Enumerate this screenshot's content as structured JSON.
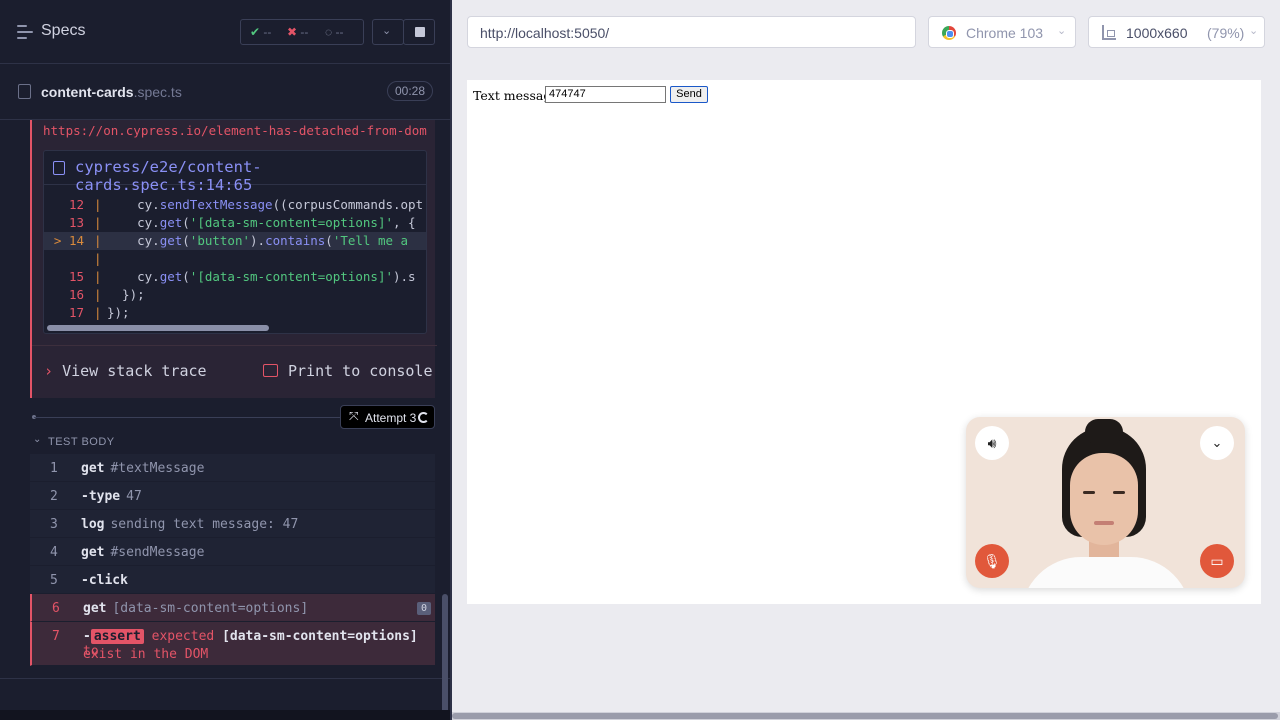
{
  "header": {
    "title": "Specs",
    "stats": {
      "passed": "--",
      "failed": "--",
      "pending": "--"
    }
  },
  "spec": {
    "name": "content-cards",
    "ext": ".spec.ts",
    "duration": "00:28"
  },
  "error": {
    "link": "https://on.cypress.io/element-has-detached-from-dom",
    "code_file": "cypress/e2e/content-cards.spec.ts:14:65",
    "code_lines": [
      {
        "num": "12",
        "pre": "    cy.",
        "fn": "sendTextMessage",
        "rest": "(corpusCommands.opt"
      },
      {
        "num": "13",
        "pre": "    cy.",
        "fn": "get",
        "str": "'[data-sm-content=options]'",
        "rest": ", {"
      },
      {
        "num": "> 14",
        "pre": "    cy.",
        "fn": "get",
        "str": "'button'",
        "rest": ").",
        "fn2": "contains",
        "str2": "'Tell me a"
      },
      {
        "num": "",
        "pre": ""
      },
      {
        "num": "15",
        "pre": "    cy.",
        "fn": "get",
        "str": "'[data-sm-content=options]'",
        "rest": ").s"
      },
      {
        "num": "16",
        "pre": "  });"
      },
      {
        "num": "17",
        "pre": "});"
      }
    ],
    "view_stack_trace": "View stack trace",
    "print_to_console": "Print to console"
  },
  "attempt": {
    "label": "Attempt 3"
  },
  "test_body": {
    "header": "TEST BODY",
    "commands": [
      {
        "num": "1",
        "name": "get",
        "arg": "#textMessage"
      },
      {
        "num": "2",
        "name": "-type",
        "arg": "47"
      },
      {
        "num": "3",
        "name": "log",
        "arg": "sending text message: 47"
      },
      {
        "num": "4",
        "name": "get",
        "arg": "#sendMessage"
      },
      {
        "num": "5",
        "name": "-click",
        "arg": ""
      },
      {
        "num": "6",
        "name": "get",
        "arg": "[data-sm-content=options]",
        "badge": "0"
      },
      {
        "num": "7",
        "name": "-",
        "tag": "assert",
        "msg_pre": "expected",
        "msg_sel": "[data-sm-content=options]",
        "msg_post": "to",
        "msg_line2": "exist in the DOM"
      }
    ]
  },
  "browser": {
    "url": "http://localhost:5050/",
    "browser_name": "Chrome 103",
    "viewport_size": "1000x660",
    "zoom": "(79%)"
  },
  "app": {
    "text_label": "Text message",
    "text_value": "474747",
    "send_label": "Send"
  },
  "icons": {
    "specs": "specs-list-icon",
    "sound": "speaker-icon",
    "collapse": "chevron-down-icon",
    "mic": "mic-off-icon",
    "cam": "camera-off-icon"
  },
  "colors": {
    "fail": "#e35467",
    "accent": "#8a90f5",
    "pass": "#52c77f",
    "video_btn": "#e1583b"
  }
}
